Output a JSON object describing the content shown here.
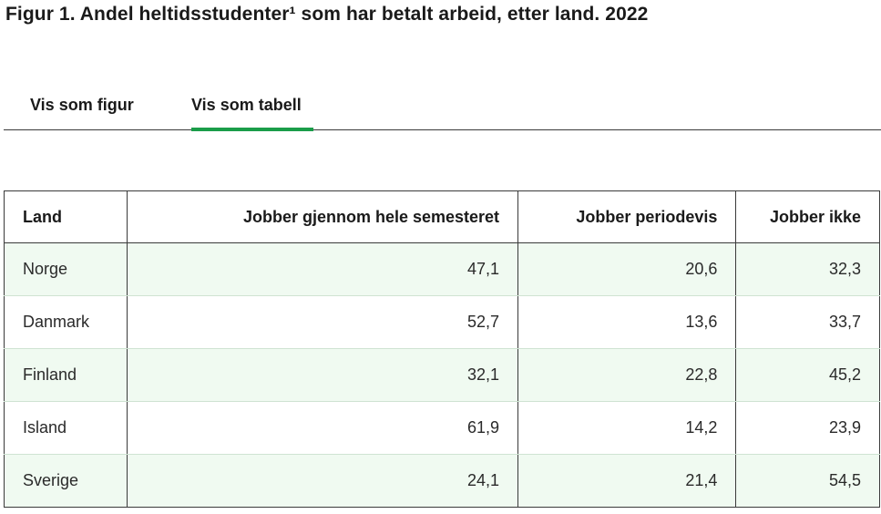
{
  "title": "Figur 1. Andel heltidsstudenter¹ som har betalt arbeid, etter land. 2022",
  "tabs": [
    {
      "label": "Vis som figur",
      "active": false
    },
    {
      "label": "Vis som tabell",
      "active": true
    }
  ],
  "colors": {
    "accent": "#1a9d49",
    "row_tint": "#f0faf1",
    "border": "#3a3a3a"
  },
  "chart_data": {
    "type": "table",
    "title": "Figur 1. Andel heltidsstudenter¹ som har betalt arbeid, etter land. 2022",
    "columns": [
      "Land",
      "Jobber gjennom hele semesteret",
      "Jobber periodevis",
      "Jobber ikke"
    ],
    "rows": [
      [
        "Norge",
        "47,1",
        "20,6",
        "32,3"
      ],
      [
        "Danmark",
        "52,7",
        "13,6",
        "33,7"
      ],
      [
        "Finland",
        "32,1",
        "22,8",
        "45,2"
      ],
      [
        "Island",
        "61,9",
        "14,2",
        "23,9"
      ],
      [
        "Sverige",
        "24,1",
        "21,4",
        "54,5"
      ]
    ]
  }
}
